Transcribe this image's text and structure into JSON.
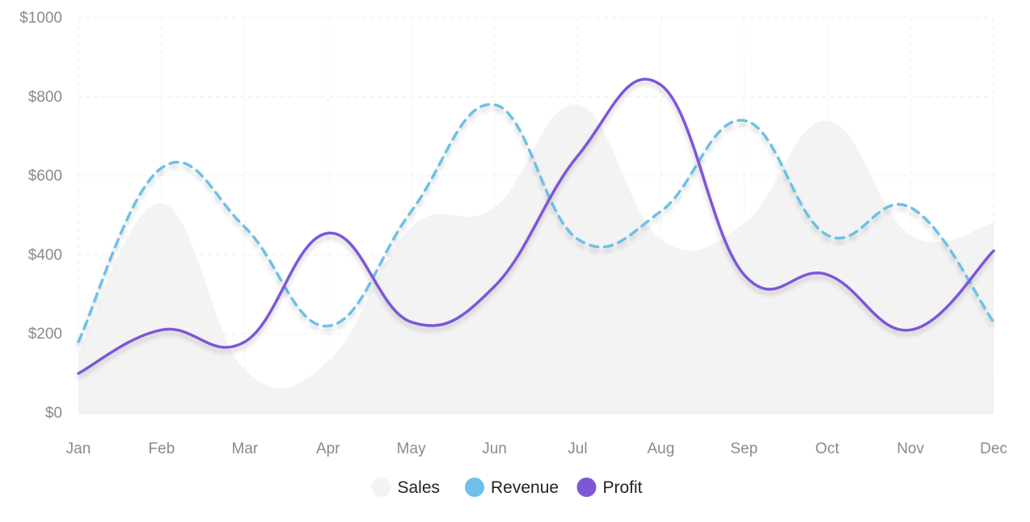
{
  "chart_data": {
    "type": "area",
    "categories": [
      "Jan",
      "Feb",
      "Mar",
      "Apr",
      "May",
      "Jun",
      "Jul",
      "Aug",
      "Sep",
      "Oct",
      "Nov",
      "Dec"
    ],
    "ylim": [
      0,
      1000
    ],
    "yticks": [
      0,
      200,
      400,
      600,
      800,
      1000
    ],
    "ytick_labels": [
      "$0",
      "$200",
      "$400",
      "$600",
      "$800",
      "$1000"
    ],
    "grid": true,
    "legend_position": "bottom",
    "series": [
      {
        "name": "Sales",
        "kind": "area",
        "color": "#f3f3f3",
        "values": [
          150,
          530,
          110,
          130,
          470,
          520,
          780,
          440,
          480,
          740,
          450,
          480
        ]
      },
      {
        "name": "Revenue",
        "kind": "dashed-line",
        "color": "#6ec0e6",
        "values": [
          180,
          620,
          470,
          220,
          510,
          780,
          440,
          510,
          740,
          450,
          520,
          230
        ]
      },
      {
        "name": "Profit",
        "kind": "line",
        "color": "#7e57d8",
        "values": [
          100,
          210,
          180,
          455,
          230,
          320,
          650,
          830,
          350,
          350,
          210,
          410
        ]
      }
    ]
  }
}
